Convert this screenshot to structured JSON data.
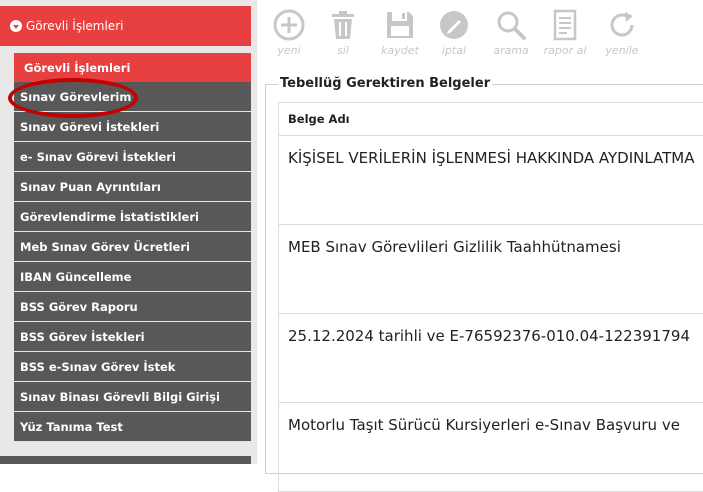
{
  "sidebar": {
    "section_title": "Görevli İşlemleri",
    "active_item": "Görevli İşlemleri",
    "items": [
      "Sınav Görevlerim",
      "Sınav Görevi İstekleri",
      "e- Sınav Görevi İstekleri",
      "Sınav Puan Ayrıntıları",
      "Görevlendirme İstatistikleri",
      "Meb Sınav Görev Ücretleri",
      "IBAN Güncelleme",
      "BSS Görev Raporu",
      "BSS Görev İstekleri",
      "BSS e-Sınav Görev İstek",
      "Sınav Binası Görevli Bilgi Girişi",
      "Yüz Tanıma Test"
    ]
  },
  "toolbar": {
    "new": "yeni",
    "delete": "sil",
    "save": "kaydet",
    "cancel": "iptal",
    "search": "arama",
    "report": "rapor al",
    "refresh": "yenile"
  },
  "panel": {
    "title": "Tebellüğ Gerektiren Belgeler",
    "column_header": "Belge Adı",
    "rows": [
      "KİŞİSEL VERİLERİN İŞLENMESİ HAKKINDA AYDINLATMA",
      "MEB Sınav Görevlileri Gizlilik Taahhütnamesi",
      "25.12.2024 tarihli ve E-76592376-010.04-122391794",
      "Motorlu Taşıt Sürücü Kursiyerleri e-Sınav Başvuru ve"
    ]
  },
  "colors": {
    "accent": "#e84040",
    "menu_bg": "#585858",
    "highlight": "#c40000",
    "toolbar_icon": "#c7c7c7"
  }
}
